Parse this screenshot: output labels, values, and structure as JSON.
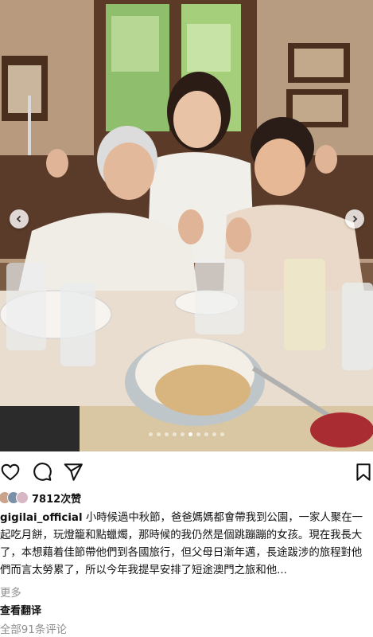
{
  "post": {
    "photo_description_name": "dinner-photo",
    "carousel_count": 10,
    "carousel_active_index": 5
  },
  "actions": {
    "like_icon": "heart-icon",
    "comment_icon": "comment-icon",
    "share_icon": "send-icon",
    "save_icon": "bookmark-icon"
  },
  "likes": {
    "count_text": "7812次赞"
  },
  "caption": {
    "username": "gigilai_official",
    "text": " 小時候過中秋節，爸爸媽媽都會帶我到公園，一家人聚在一起吃月餅，玩燈籠和點蠟燭，那時候的我仍然是個跳蹦蹦的女孩。現在我長大了，本想藉着佳節帶他們到各國旅行，但父母日漸年邁，長途跋涉的旅程對他們而言太勞累了，所以今年我提早安排了短途澳門之旅和他...",
    "more_label": "更多"
  },
  "translate_label": "查看翻译",
  "comments_label": "全部91条评论"
}
